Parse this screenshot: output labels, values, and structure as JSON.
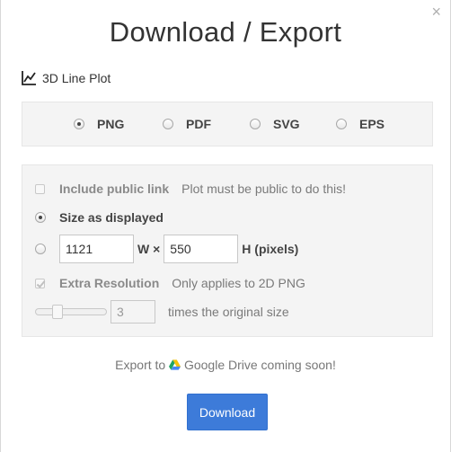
{
  "dialog": {
    "title": "Download / Export",
    "close_symbol": "×"
  },
  "plot": {
    "icon": "line-chart-icon",
    "name": "3D Line Plot"
  },
  "formats": {
    "selected": "PNG",
    "options": [
      {
        "label": "PNG",
        "checked": true
      },
      {
        "label": "PDF",
        "checked": false
      },
      {
        "label": "SVG",
        "checked": false
      },
      {
        "label": "EPS",
        "checked": false
      }
    ]
  },
  "options": {
    "public_link": {
      "label": "Include public link",
      "hint": "Plot must be public to do this!",
      "checked": false,
      "enabled": false
    },
    "size_as_displayed": {
      "label": "Size as displayed",
      "checked": true
    },
    "custom_size": {
      "checked": false,
      "width": "1121",
      "width_label": "W ×",
      "height": "550",
      "height_label": "H (pixels)"
    },
    "extra_resolution": {
      "label": "Extra Resolution",
      "hint": "Only applies to 2D PNG",
      "checked": true,
      "enabled": false,
      "multiplier": "3",
      "multiplier_label": "times the original size"
    }
  },
  "export_note": {
    "prefix": "Export to",
    "service_icon": "google-drive-icon",
    "suffix": "Google Drive coming soon!"
  },
  "download_button": {
    "label": "Download"
  },
  "colors": {
    "primary": "#3d7bd9",
    "panel": "#f4f4f4"
  }
}
